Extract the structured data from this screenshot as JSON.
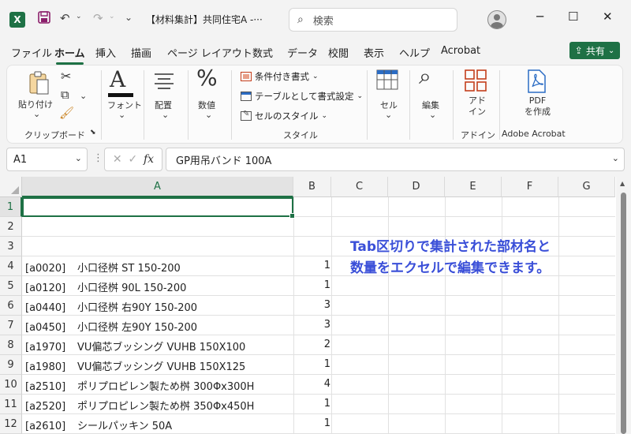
{
  "titlebar": {
    "app_icon": "X",
    "doc_title": "【材料集計】共同住宅A  -···",
    "search_placeholder": "検索",
    "minimize": "─",
    "maximize": "☐",
    "close": "✕"
  },
  "menu": {
    "tabs": [
      "ファイル",
      "ホーム",
      "挿入",
      "描画",
      "ページ レイアウト",
      "数式",
      "データ",
      "校閲",
      "表示",
      "ヘルプ",
      "Acrobat"
    ],
    "active": "ホーム",
    "share_label": "共有"
  },
  "ribbon": {
    "paste_label": "貼り付け",
    "clipboard_label": "クリップボード",
    "font_label": "フォント",
    "align_label": "配置",
    "number_label": "数値",
    "cond_format": "条件付き書式",
    "table_format": "テーブルとして書式設定",
    "cell_style": "セルのスタイル",
    "style_group": "スタイル",
    "cells_label": "セル",
    "edit_label": "編集",
    "addin_label": "アド\nイン",
    "addin_group": "アドイン",
    "pdf_label": "PDF\nを作成",
    "acrobat_group": "Adobe Acrobat"
  },
  "formula_bar": {
    "name_box": "A1",
    "fx": "fx",
    "formula": "GP用吊バンド 100A"
  },
  "grid": {
    "columns": [
      "A",
      "B",
      "C",
      "D",
      "E",
      "F",
      "G"
    ],
    "selected_column": "A",
    "selected_row": "1",
    "rows": [
      {
        "num": "1",
        "code": "",
        "name": "",
        "qty": ""
      },
      {
        "num": "2",
        "code": "",
        "name": "",
        "qty": ""
      },
      {
        "num": "3",
        "code": "",
        "name": "",
        "qty": ""
      },
      {
        "num": "4",
        "code": "[a0020]",
        "name": "小口径桝 ST 150-200",
        "qty": "1"
      },
      {
        "num": "5",
        "code": "[a0120]",
        "name": "小口径桝 90L 150-200",
        "qty": "1"
      },
      {
        "num": "6",
        "code": "[a0440]",
        "name": "小口径桝 右90Y 150-200",
        "qty": "3"
      },
      {
        "num": "7",
        "code": "[a0450]",
        "name": "小口径桝 左90Y 150-200",
        "qty": "3"
      },
      {
        "num": "8",
        "code": "[a1970]",
        "name": "VU偏芯ブッシング VUHB 150X100",
        "qty": "2"
      },
      {
        "num": "9",
        "code": "[a1980]",
        "name": "VU偏芯ブッシング VUHB 150X125",
        "qty": "1"
      },
      {
        "num": "10",
        "code": "[a2510]",
        "name": "ポリプロピレン製ため桝 300Φx300H",
        "qty": "4"
      },
      {
        "num": "11",
        "code": "[a2520]",
        "name": "ポリプロピレン製ため桝 350Φx450H",
        "qty": "1"
      },
      {
        "num": "12",
        "code": "[a2610]",
        "name": "シールパッキン 50A",
        "qty": "1"
      }
    ],
    "note_line1": "Tab区切りで集計された部材名と",
    "note_line2": "数量をエクセルで編集できます。"
  }
}
